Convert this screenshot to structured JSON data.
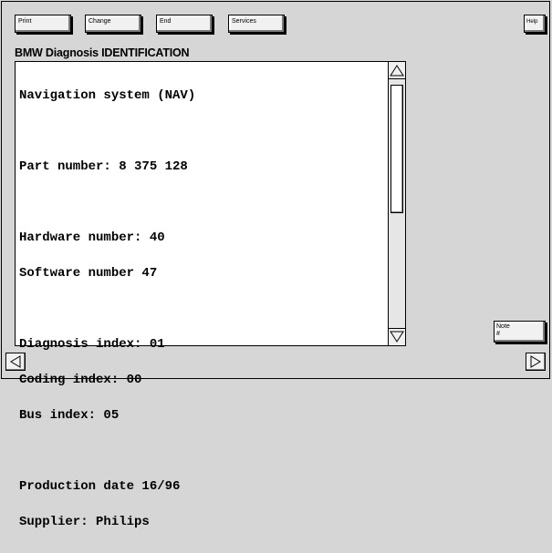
{
  "toolbar": {
    "print_label": "Print",
    "change_label": "Change",
    "end_label": "End",
    "services_label": "Services",
    "help_label": "Help"
  },
  "title": "BMW Diagnosis IDENTIFICATION",
  "content_lines": [
    "Navigation system (NAV)",
    "",
    "Part number: 8 375 128",
    "",
    "Hardware number: 40",
    "Software number 47",
    "",
    "Diagnosis index: 01",
    "Coding index: 00",
    "Bus index: 05",
    "",
    "Production date 16/96",
    "Supplier: Philips"
  ],
  "note": {
    "label": "Note",
    "symbol": "#"
  },
  "icons": {
    "scroll_up": "triangle-up-icon",
    "scroll_down": "triangle-down-icon",
    "page_back": "triangle-left-icon",
    "page_forward": "triangle-right-icon"
  }
}
